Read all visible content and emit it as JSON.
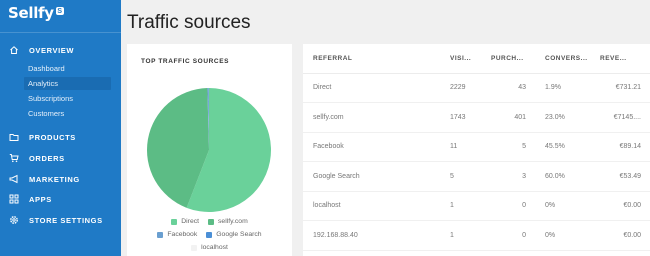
{
  "app": {
    "brand": "Sellfy",
    "badge": "S"
  },
  "sidebar": {
    "items": [
      {
        "label": "OVERVIEW",
        "icon": "home-icon"
      },
      {
        "label": "PRODUCTS",
        "icon": "folder-icon"
      },
      {
        "label": "ORDERS",
        "icon": "cart-icon"
      },
      {
        "label": "MARKETING",
        "icon": "megaphone-icon"
      },
      {
        "label": "APPS",
        "icon": "apps-icon"
      },
      {
        "label": "STORE SETTINGS",
        "icon": "gear-icon"
      }
    ],
    "overview_sub": [
      {
        "label": "Dashboard"
      },
      {
        "label": "Analytics",
        "active": true
      },
      {
        "label": "Subscriptions"
      },
      {
        "label": "Customers"
      }
    ]
  },
  "page": {
    "title": "Traffic sources"
  },
  "chart_card": {
    "title": "TOP TRAFFIC SOURCES",
    "legend": [
      "Direct",
      "sellfy.com",
      "Facebook",
      "Google Search",
      "localhost"
    ]
  },
  "chart_data": {
    "type": "pie",
    "title": "TOP TRAFFIC SOURCES",
    "labels": [
      "Direct",
      "sellfy.com",
      "Facebook",
      "Google Search",
      "localhost"
    ],
    "values": [
      2229,
      1743,
      11,
      5,
      1
    ],
    "colors": [
      "#6ad19a",
      "#5cbc85",
      "#6a9fd0",
      "#4b8fd6",
      "#f2f2f2"
    ],
    "legend_position": "bottom"
  },
  "table": {
    "headers": [
      "REFERRAL",
      "VISI...",
      "PURCH...",
      "CONVERS...",
      "REVE..."
    ],
    "rows": [
      [
        "Direct",
        "2229",
        "43",
        "1.9%",
        "€731.21"
      ],
      [
        "sellfy.com",
        "1743",
        "401",
        "23.0%",
        "€7145...."
      ],
      [
        "Facebook",
        "11",
        "5",
        "45.5%",
        "€89.14"
      ],
      [
        "Google Search",
        "5",
        "3",
        "60.0%",
        "€53.49"
      ],
      [
        "localhost",
        "1",
        "0",
        "0%",
        "€0.00"
      ],
      [
        "192.168.88.40",
        "1",
        "0",
        "0%",
        "€0.00"
      ]
    ]
  },
  "theme": {
    "sidebar": "#1f7ac6",
    "active_item": "#1a6cb2"
  }
}
